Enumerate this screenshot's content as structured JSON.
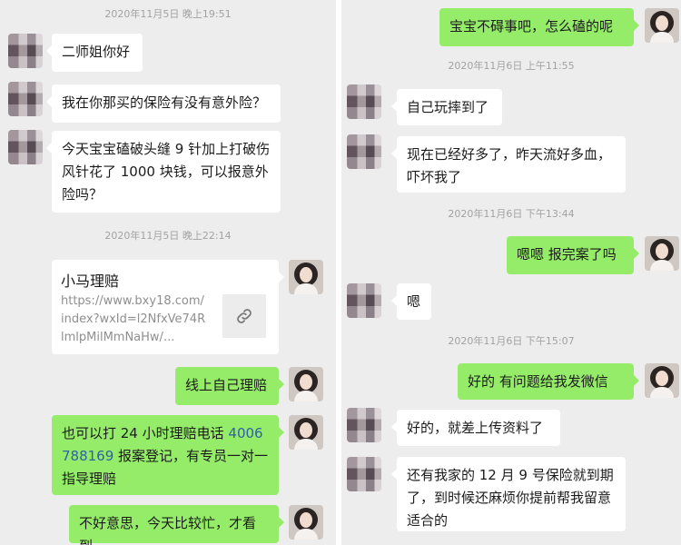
{
  "left": {
    "messages": [
      {
        "type": "timestamp",
        "text": "2020年11月5日 晚上19:51"
      },
      {
        "type": "in",
        "text": "二师姐你好"
      },
      {
        "type": "in",
        "text": "我在你那买的保险有没有意外险？"
      },
      {
        "type": "in",
        "text": "今天宝宝磕破头缝 9 针加上打破伤风针花了 1000 块钱，可以报意外险吗？"
      },
      {
        "type": "timestamp",
        "text": "2020年11月5日 晚上22:14"
      },
      {
        "type": "link-card",
        "title": "小马理赔",
        "url": "https://www.bxy18.com/index?wxId=l2NfxVe74RlmlpMilMmNaHw/..."
      },
      {
        "type": "out",
        "text": "线上自己理赔"
      },
      {
        "type": "out",
        "text_before": "也可以打 24 小时理赔电话 ",
        "phone": "4006788169",
        "text_after": " 报案登记，有专员一对一指导理赔"
      },
      {
        "type": "out",
        "text": "不好意思，今天比较忙，才看到"
      }
    ]
  },
  "right": {
    "messages": [
      {
        "type": "out",
        "text": "宝宝不碍事吧，怎么磕的呢"
      },
      {
        "type": "timestamp",
        "text": "2020年11月6日 上午11:55"
      },
      {
        "type": "in",
        "text": "自己玩摔到了"
      },
      {
        "type": "in",
        "text": "现在已经好多了，昨天流好多血，吓坏我了"
      },
      {
        "type": "timestamp",
        "text": "2020年11月6日 下午13:44"
      },
      {
        "type": "out",
        "text": "嗯嗯 报完案了吗"
      },
      {
        "type": "in",
        "text": "嗯"
      },
      {
        "type": "timestamp",
        "text": "2020年11月6日 下午15:07"
      },
      {
        "type": "out",
        "text": "好的 有问题给我发微信"
      },
      {
        "type": "in",
        "text": "好的，就差上传资料了"
      },
      {
        "type": "in",
        "text": "还有我家的 12 月 9 号保险就到期了，到时候还麻烦你提前帮我留意适合的"
      }
    ]
  },
  "icons": {
    "link": "link-icon",
    "contact_avatar": "blurred-avatar",
    "agent_avatar": "agent-photo-avatar"
  }
}
